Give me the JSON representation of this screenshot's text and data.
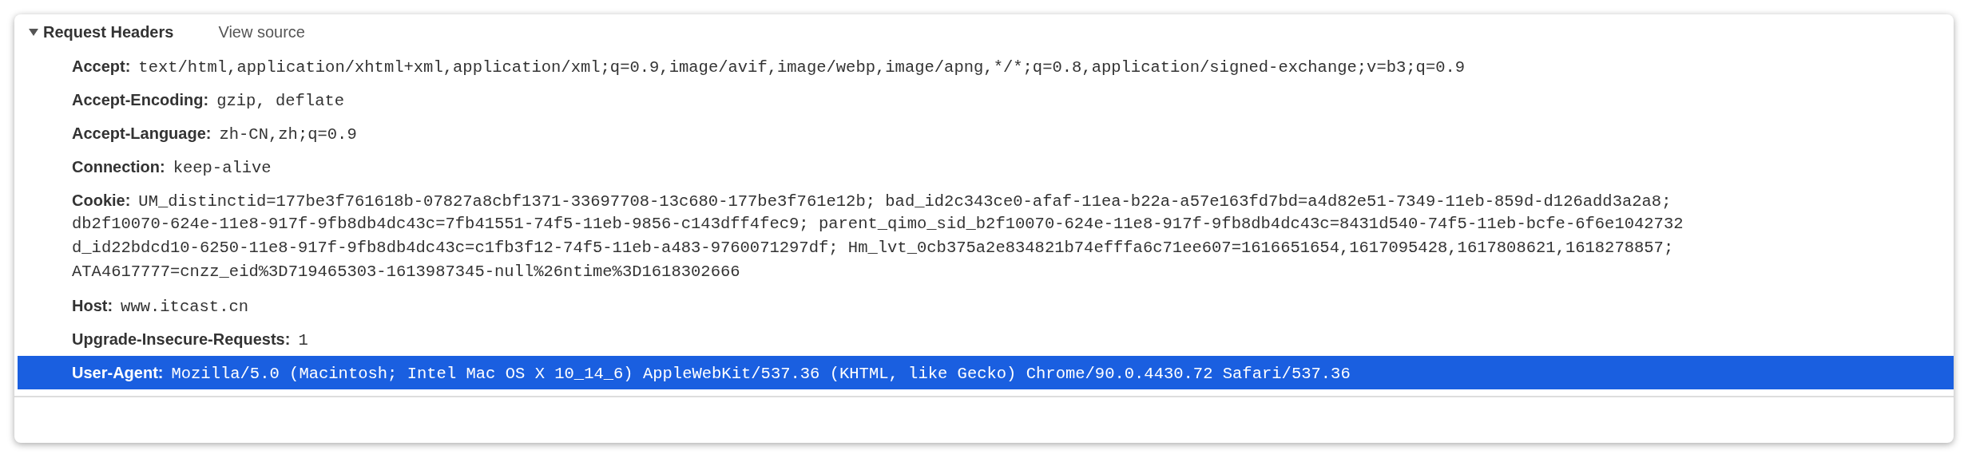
{
  "section": {
    "title": "Request Headers",
    "expanded": true,
    "view_source": "View source"
  },
  "headers": [
    {
      "name": "Accept:",
      "value_lines": [
        "text/html,application/xhtml+xml,application/xml;q=0.9,image/avif,image/webp,image/apng,*/*;q=0.8,application/signed-exchange;v=b3;q=0.9"
      ],
      "selected": false
    },
    {
      "name": "Accept-Encoding:",
      "value_lines": [
        "gzip, deflate"
      ],
      "selected": false
    },
    {
      "name": "Accept-Language:",
      "value_lines": [
        "zh-CN,zh;q=0.9"
      ],
      "selected": false
    },
    {
      "name": "Connection:",
      "value_lines": [
        "keep-alive"
      ],
      "selected": false
    },
    {
      "name": "Cookie:",
      "value_lines": [
        "UM_distinctid=177be3f761618b-07827a8cbf1371-33697708-13c680-177be3f761e12b; bad_id2c343ce0-afaf-11ea-b22a-a57e163fd7bd=a4d82e51-7349-11eb-859d-d126add3a2a8;",
        "db2f10070-624e-11e8-917f-9fb8db4dc43c=7fb41551-74f5-11eb-9856-c143dff4fec9; parent_qimo_sid_b2f10070-624e-11e8-917f-9fb8db4dc43c=8431d540-74f5-11eb-bcfe-6f6e1042732",
        "d_id22bdcd10-6250-11e8-917f-9fb8db4dc43c=c1fb3f12-74f5-11eb-a483-9760071297df; Hm_lvt_0cb375a2e834821b74efffa6c71ee607=1616651654,1617095428,1617808621,1618278857;",
        "ATA4617777=cnzz_eid%3D719465303-1613987345-null%26ntime%3D1618302666"
      ],
      "selected": false
    },
    {
      "name": "Host:",
      "value_lines": [
        "www.itcast.cn"
      ],
      "selected": false
    },
    {
      "name": "Upgrade-Insecure-Requests:",
      "value_lines": [
        "1"
      ],
      "selected": false
    },
    {
      "name": "User-Agent:",
      "value_lines": [
        "Mozilla/5.0 (Macintosh; Intel Mac OS X 10_14_6) AppleWebKit/537.36 (KHTML, like Gecko) Chrome/90.0.4430.72 Safari/537.36"
      ],
      "selected": true
    }
  ]
}
